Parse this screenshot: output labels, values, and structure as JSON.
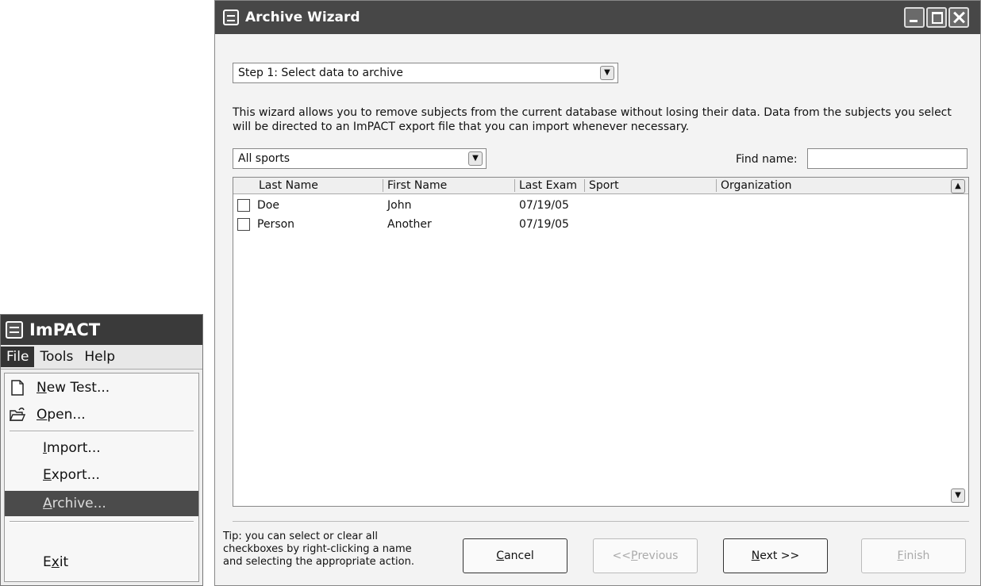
{
  "menu_window": {
    "title": "ImPACT",
    "menubar": [
      "File",
      "Tools",
      "Help"
    ],
    "items": [
      {
        "mnemonic": "N",
        "rest": "ew Test..."
      },
      {
        "mnemonic": "O",
        "rest": "pen..."
      },
      {
        "mnemonic": "I",
        "rest": "mport..."
      },
      {
        "mnemonic": "E",
        "rest": "xport..."
      },
      {
        "mnemonic": "A",
        "rest": "rchive..."
      },
      {
        "pre": "E",
        "mnemonic": "x",
        "rest": "it"
      }
    ]
  },
  "wizard": {
    "title": "Archive Wizard",
    "step_select": "Step 1: Select data to archive",
    "description": "This wizard allows you to remove subjects from the current database without losing their data.  Data from the subjects you select will be directed to an ImPACT export file that you can import whenever necessary.",
    "sport_filter": "All sports",
    "find_label": "Find name:",
    "find_value": "",
    "columns": [
      "Last Name",
      "First Name",
      "Last Exam",
      "Sport",
      "Organization"
    ],
    "rows": [
      {
        "last": "Doe",
        "first": "John",
        "exam": "07/19/05",
        "sport": "",
        "org": ""
      },
      {
        "last": "Person",
        "first": "Another",
        "exam": "07/19/05",
        "sport": "",
        "org": ""
      }
    ],
    "tip": "Tip: you can select or clear all checkboxes by right-clicking a name and selecting the appropriate action.",
    "buttons": {
      "cancel": {
        "mnemonic": "C",
        "rest": "ancel"
      },
      "previous": {
        "pre": "<< ",
        "mnemonic": "P",
        "rest": "revious"
      },
      "next": {
        "mnemonic": "N",
        "rest": "ext >>"
      },
      "finish": {
        "mnemonic": "F",
        "rest": "inish"
      }
    }
  }
}
